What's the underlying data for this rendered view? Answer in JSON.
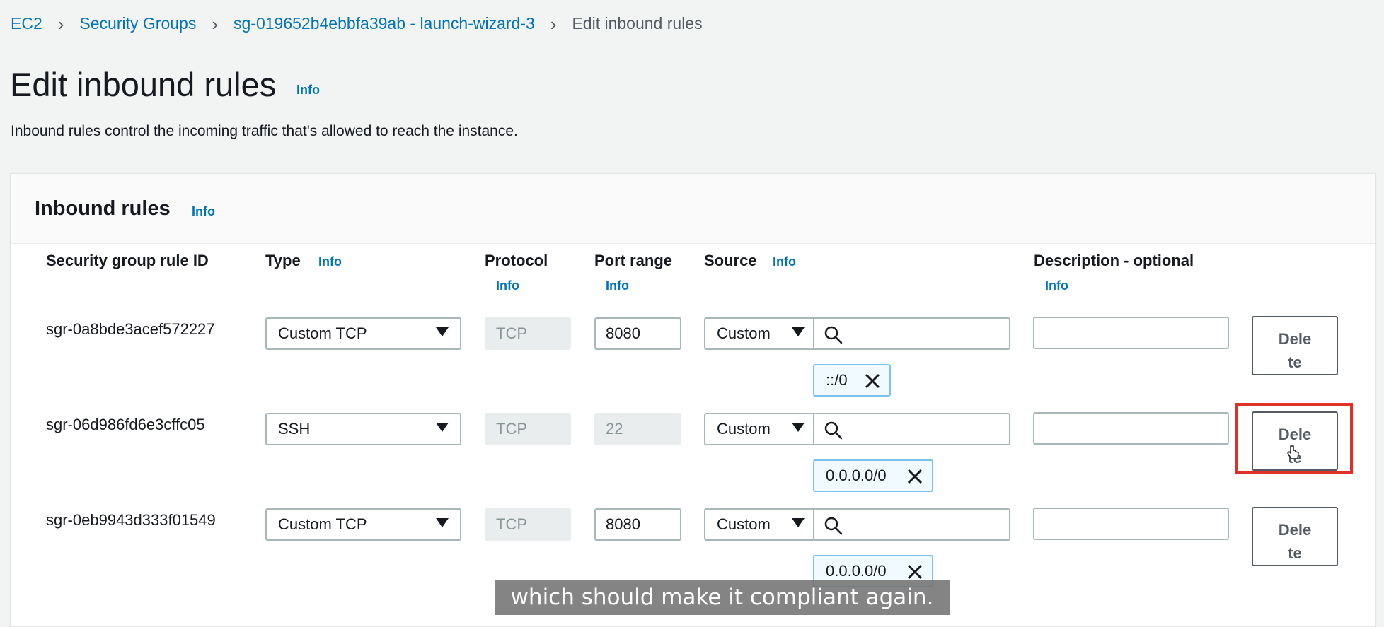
{
  "breadcrumb": [
    {
      "label": "EC2"
    },
    {
      "label": "Security Groups"
    },
    {
      "label": "sg-019652b4ebbfa39ab - launch-wizard-3"
    },
    {
      "label": "Edit inbound rules"
    }
  ],
  "page": {
    "title": "Edit inbound rules",
    "info": "Info",
    "description": "Inbound rules control the incoming traffic that's allowed to reach the instance."
  },
  "panel": {
    "title": "Inbound rules",
    "info": "Info"
  },
  "columns": {
    "rule_id": "Security group rule ID",
    "type": "Type",
    "type_info": "Info",
    "protocol": "Protocol",
    "protocol_info": "Info",
    "port_range": "Port range",
    "port_info": "Info",
    "source": "Source",
    "source_info": "Info",
    "description": "Description - optional",
    "description_info": "Info"
  },
  "rules": [
    {
      "id": "sgr-0a8bde3acef572227",
      "type": "Custom TCP",
      "protocol": "TCP",
      "port": "8080",
      "port_disabled": false,
      "source": "Custom",
      "cidr": "::/0",
      "description": "",
      "delete_line1": "Dele",
      "delete_line2": "te"
    },
    {
      "id": "sgr-06d986fd6e3cffc05",
      "type": "SSH",
      "protocol": "TCP",
      "port": "22",
      "port_disabled": true,
      "source": "Custom",
      "cidr": "0.0.0.0/0",
      "description": "",
      "delete_line1": "Dele",
      "delete_line2": "te"
    },
    {
      "id": "sgr-0eb9943d333f01549",
      "type": "Custom TCP",
      "protocol": "TCP",
      "port": "8080",
      "port_disabled": false,
      "source": "Custom",
      "cidr": "0.0.0.0/0",
      "description": "",
      "delete_line1": "Dele",
      "delete_line2": "te"
    }
  ],
  "caption": "which should make it compliant again.",
  "icons": {
    "search": "search-icon",
    "remove": "close-icon",
    "dropdown": "caret-down-icon",
    "pointer": "hand-pointer-icon"
  },
  "colors": {
    "link": "#0073bb",
    "highlight": "#e03127",
    "token_bg": "#f1faff",
    "token_border": "#7ac3ee"
  }
}
